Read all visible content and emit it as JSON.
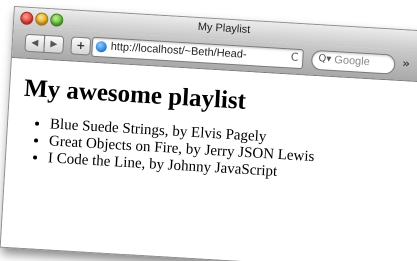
{
  "window": {
    "title": "My Playlist"
  },
  "toolbar": {
    "back_label": "◀",
    "forward_label": "▶",
    "add_label": "+",
    "url": "http://localhost/~Beth/Head-",
    "reload_label": "C",
    "search_placeholder": "Google",
    "overflow_label": "»"
  },
  "page": {
    "heading": "My awesome playlist",
    "tracks": [
      "Blue Suede Strings, by Elvis Pagely",
      "Great Objects on Fire, by Jerry JSON Lewis",
      "I Code the Line, by Johnny JavaScript"
    ]
  },
  "colors": {
    "close": "#e0392f",
    "minimize": "#e1a21a",
    "zoom": "#55b42a",
    "toolbar": "#b9b9b9"
  },
  "icons": [
    "close-icon",
    "minimize-icon",
    "zoom-icon",
    "back-icon",
    "forward-icon",
    "add-icon",
    "globe-icon",
    "reload-icon",
    "search-icon",
    "overflow-icon"
  ]
}
